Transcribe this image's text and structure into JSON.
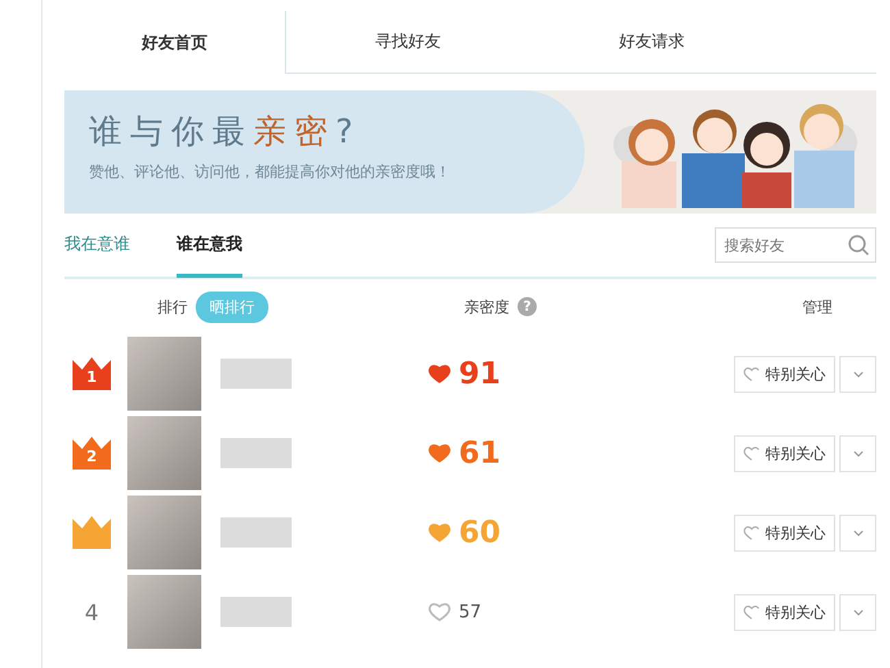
{
  "tabs": [
    {
      "label": "好友首页",
      "selected": true
    },
    {
      "label": "寻找好友",
      "selected": false
    },
    {
      "label": "好友请求",
      "selected": false
    }
  ],
  "banner": {
    "title": [
      {
        "text": "谁与你最",
        "highlight": false
      },
      {
        "text": "亲密",
        "highlight": true
      },
      {
        "text": "?",
        "highlight": false
      }
    ],
    "subtitle": "赞他、评论他、访问他，都能提高你对他的亲密度哦！"
  },
  "subtabs": [
    {
      "label": "我在意谁",
      "selected": false
    },
    {
      "label": "谁在意我",
      "selected": true
    }
  ],
  "search": {
    "placeholder": "搜索好友"
  },
  "columns": {
    "rank": "排行",
    "share": "晒排行",
    "intimacy": "亲密度",
    "help": "?",
    "manage": "管理"
  },
  "rows": [
    {
      "kind": "crown",
      "rank": "1",
      "color": "#e8401c",
      "score": "91",
      "action": "特别关心"
    },
    {
      "kind": "crown",
      "rank": "2",
      "color": "#f26b1d",
      "score": "61",
      "action": "特别关心"
    },
    {
      "kind": "badge",
      "color": "#f5a533",
      "score": "60",
      "action": "特别关心"
    },
    {
      "kind": "plain",
      "rank": "4",
      "color": "#bbbbbb",
      "score": "57",
      "action": "特别关心"
    }
  ]
}
